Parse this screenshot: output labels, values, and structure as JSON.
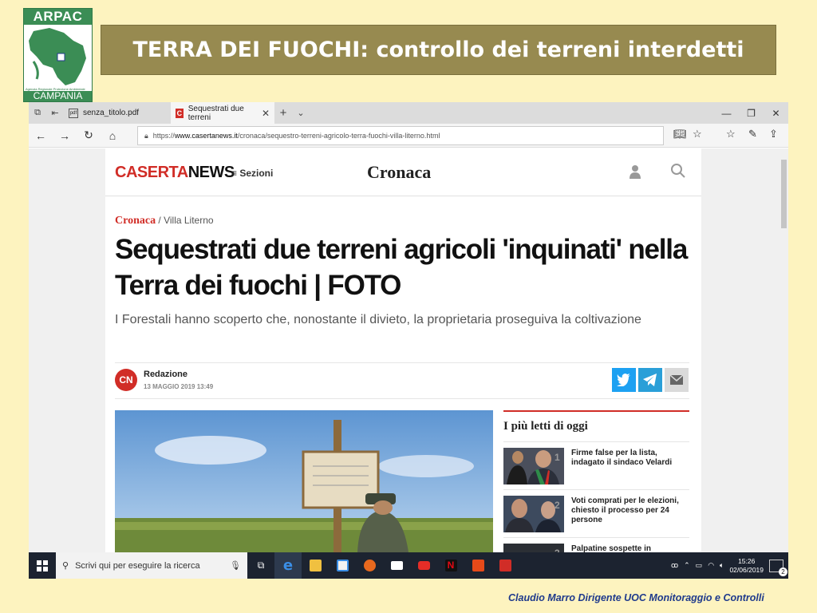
{
  "slide": {
    "logo_top": "ARPAC",
    "logo_small": "Agenzia Regionale Protezione Ambientale",
    "logo_bottom": "CAMPANIA",
    "title": "TERRA DEI FUOCHI: controllo dei terreni interdetti",
    "footer": "Claudio Marro Dirigente UOC Monitoraggio e Controlli"
  },
  "browser": {
    "tabs": [
      {
        "label": "senza_titolo.pdf",
        "favicon": "pdf"
      },
      {
        "label": "Sequestrati due terreni",
        "favicon": "C",
        "active": true
      }
    ],
    "url_prefix": "https://",
    "url_domain": "www.casertanews.it",
    "url_path": "/cronaca/sequestro-terreni-agricolo-terra-fuochi-villa-literno.html"
  },
  "site": {
    "brand_part1": "CASERTA",
    "brand_part2": "NEWS",
    "menu_label": "Sezioni",
    "section": "Cronaca",
    "breadcrumb_category": "Cronaca",
    "breadcrumb_sep": " / ",
    "breadcrumb_place": "Villa Literno",
    "headline": "Sequestrati due terreni agricoli 'inquinati' nella Terra dei fuochi | FOTO",
    "subtitle": "I Forestali hanno scoperto che, nonostante il divieto, la proprietaria proseguiva la coltivazione",
    "author_initials": "CN",
    "author": "Redazione",
    "date": "13 MAGGIO 2019 13:49",
    "popular_title": "I più letti di oggi",
    "popular": [
      {
        "num": "1",
        "text": "Firme false per la lista, indagato il sindaco Velardi"
      },
      {
        "num": "2",
        "text": "Voti comprati per le elezioni, chiesto il processo per 24 persone"
      },
      {
        "num": "3",
        "text": "Palpatine sospette in"
      }
    ]
  },
  "taskbar": {
    "search_placeholder": "Scrivi qui per eseguire la ricerca",
    "time": "15:26",
    "date": "02/06/2019",
    "notifications": "2"
  },
  "colors": {
    "slide_bg": "#fdf3bf",
    "title_bar": "#978a50",
    "brand_red": "#d12d27",
    "footer_blue": "#1f3a8c"
  }
}
